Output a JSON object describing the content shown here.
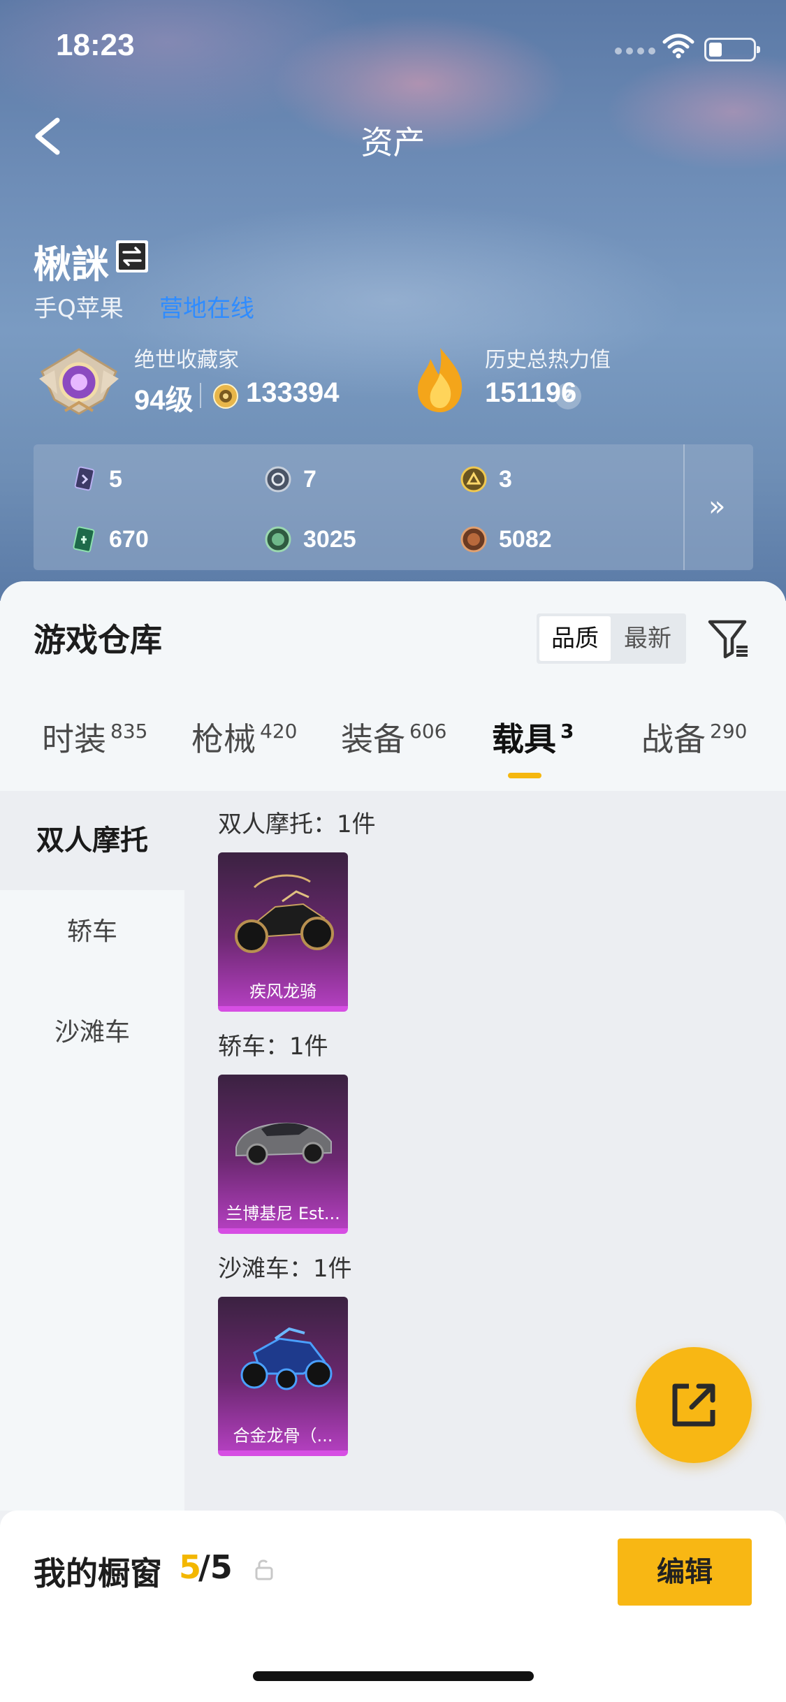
{
  "status_bar": {
    "time": "18:23"
  },
  "nav": {
    "title": "资产"
  },
  "profile": {
    "name": "楸詸",
    "platform": "手Q苹果",
    "online_status": "营地在线",
    "collector_title": "绝世收藏家",
    "collector_level": "94级",
    "collector_points": "133394",
    "heat_title": "历史总热力值",
    "heat_value": "151196",
    "help_mark": "?"
  },
  "stats": {
    "row1": [
      "5",
      "7",
      "3"
    ],
    "row2": [
      "670",
      "3025",
      "5082"
    ],
    "more": "»"
  },
  "warehouse": {
    "title": "游戏仓库",
    "sort_options": [
      "品质",
      "最新"
    ],
    "tabs": [
      {
        "label": "时装",
        "count": "835"
      },
      {
        "label": "枪械",
        "count": "420"
      },
      {
        "label": "装备",
        "count": "606"
      },
      {
        "label": "载具",
        "count": "3"
      },
      {
        "label": "战备",
        "count": "290"
      }
    ],
    "side_nav": [
      "双人摩托",
      "轿车",
      "沙滩车"
    ],
    "groups": [
      {
        "title": "双人摩托：1件",
        "item": "疾风龙骑"
      },
      {
        "title": "轿车：1件",
        "item": "兰博基尼 Est..."
      },
      {
        "title": "沙滩车：1件",
        "item": "合金龙骨（..."
      }
    ]
  },
  "showcase": {
    "label": "我的橱窗",
    "count": "5",
    "total": "/5",
    "edit_label": "编辑"
  },
  "colors": {
    "accent": "#f8b714",
    "online": "#2f8cff",
    "card_purple": "#b23fbe"
  }
}
